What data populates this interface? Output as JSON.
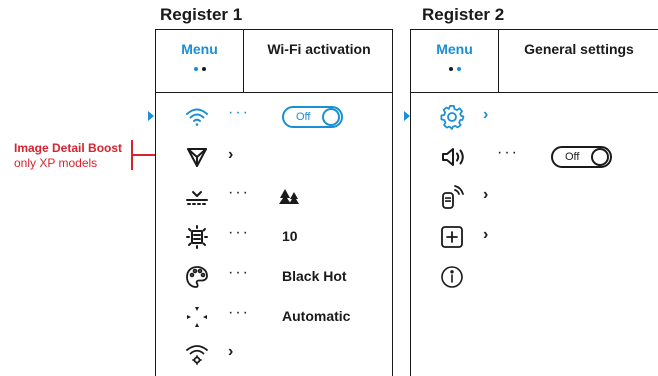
{
  "register1": {
    "title": "Register 1",
    "tabs": [
      {
        "label": "Menu",
        "active": true
      },
      {
        "label": "Wi-Fi activation",
        "active": false
      }
    ],
    "rows": [
      {
        "icon": "wifi-icon",
        "selected": true,
        "ellipsis": "···",
        "toggle": "Off"
      },
      {
        "icon": "image-detail-boost-icon",
        "chevron": "›"
      },
      {
        "icon": "scene-mode-icon",
        "ellipsis": "···",
        "value_icon": "trees-icon"
      },
      {
        "icon": "brightness-level-icon",
        "ellipsis": "···",
        "value": "10"
      },
      {
        "icon": "color-palette-icon",
        "ellipsis": "···",
        "value": "Black Hot"
      },
      {
        "icon": "calibration-mode-icon",
        "ellipsis": "···",
        "value": "Automatic"
      },
      {
        "icon": "wifi-settings-icon",
        "chevron": "›"
      }
    ]
  },
  "register2": {
    "title": "Register 2",
    "tabs": [
      {
        "label": "Menu",
        "active": true
      },
      {
        "label": "General settings",
        "active": false
      }
    ],
    "rows": [
      {
        "icon": "gear-icon",
        "selected": true,
        "chevron": "›"
      },
      {
        "icon": "speaker-icon",
        "ellipsis": "···",
        "toggle": "Off"
      },
      {
        "icon": "remote-control-icon",
        "chevron": "›"
      },
      {
        "icon": "add-icon",
        "chevron": "›"
      },
      {
        "icon": "info-icon"
      }
    ]
  },
  "callout": {
    "title": "Image Detail Boost",
    "subtitle": "only XP models"
  },
  "colors": {
    "accent": "#1a8fd4",
    "callout": "#d5232f",
    "text": "#1a1a1a"
  }
}
